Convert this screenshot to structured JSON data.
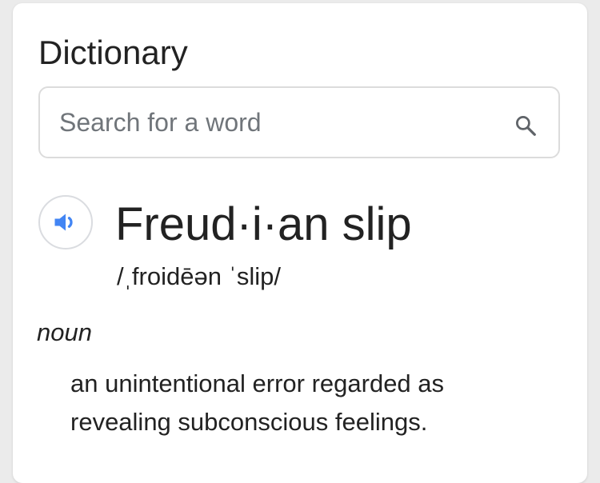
{
  "dictionary": {
    "title": "Dictionary",
    "search": {
      "placeholder": "Search for a word",
      "value": "",
      "icon": "search-icon"
    },
    "entry": {
      "speaker_icon": "speaker-icon",
      "headword": "Freud·i·an slip",
      "pronunciation": "/ˌfroidēən ˈslip/",
      "part_of_speech": "noun",
      "definition": "an unintentional error regarded as revealing subconscious feelings."
    }
  },
  "colors": {
    "text": "#222222",
    "placeholder": "#70757a",
    "speaker_accent": "#4285f4",
    "border": "#dadce0",
    "background": "#ebebeb",
    "card": "#ffffff"
  }
}
